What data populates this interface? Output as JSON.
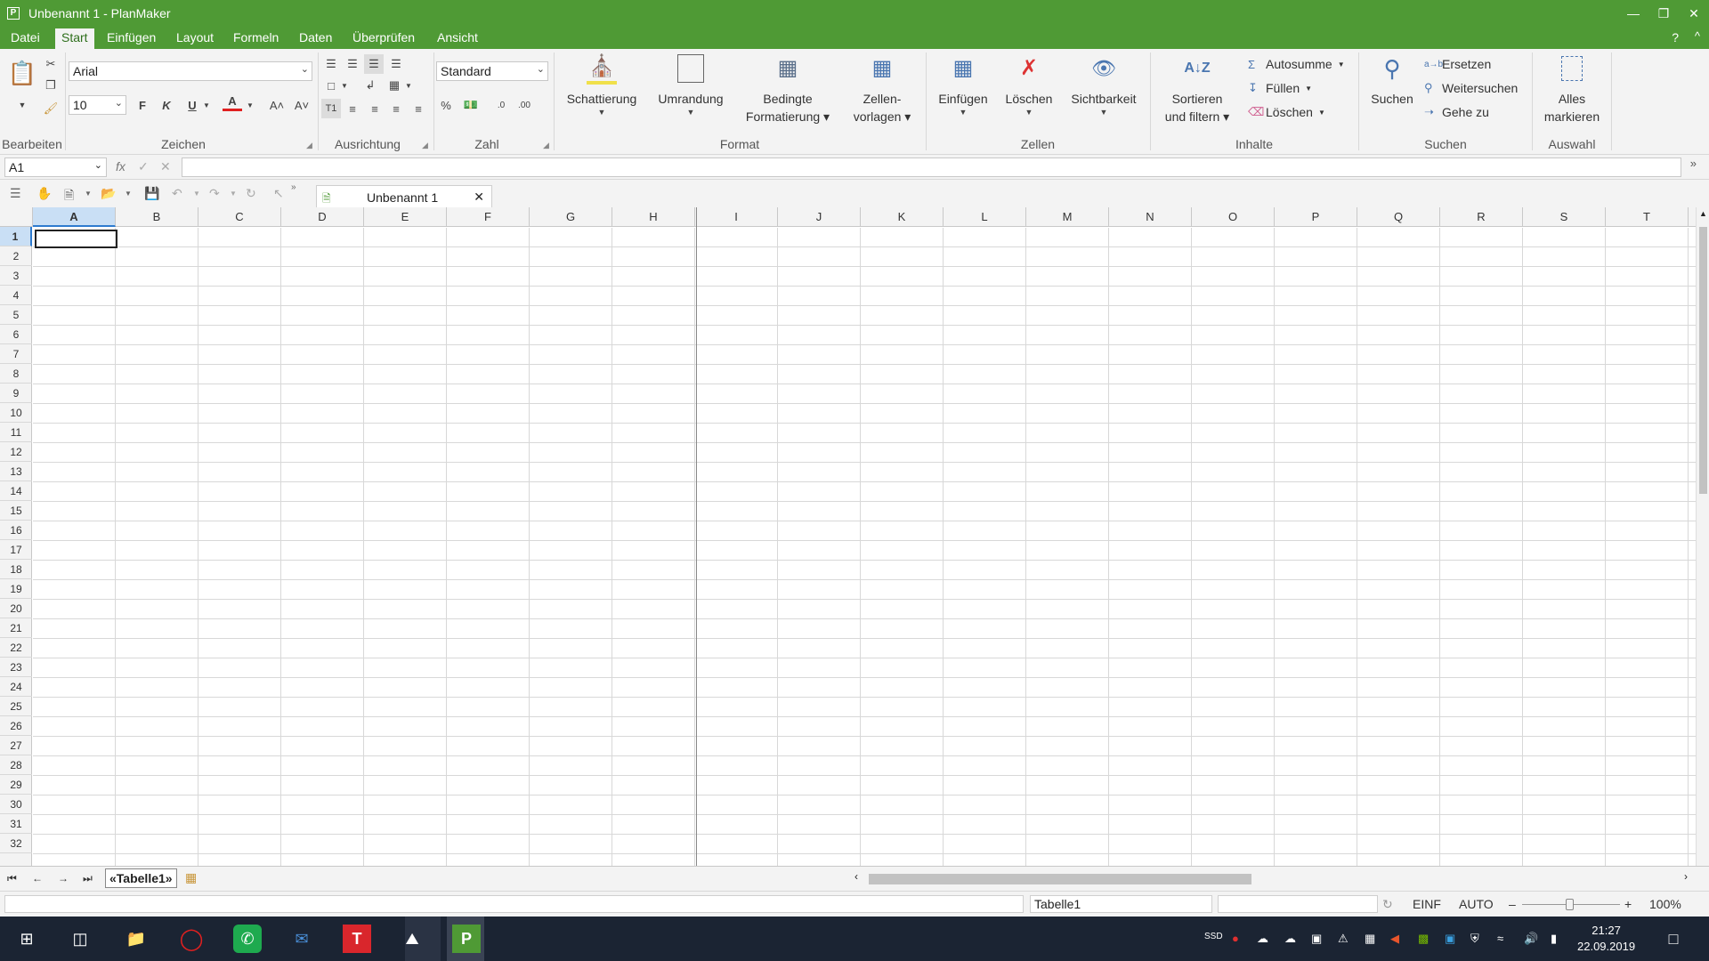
{
  "window": {
    "title": "Unbenannt 1 - PlanMaker",
    "app_icon_letter": "P"
  },
  "menu": {
    "items": [
      "Datei",
      "Start",
      "Einfügen",
      "Layout",
      "Formeln",
      "Daten",
      "Überprüfen",
      "Ansicht"
    ],
    "active": "Start",
    "help": "?",
    "collapse": "^"
  },
  "ribbon": {
    "font_name": "Arial",
    "font_size": "10",
    "number_format": "Standard",
    "bold_label": "F",
    "italic_label": "K",
    "underline_label": "U",
    "font_color_label": "A",
    "grow_label": "A˄",
    "shrink_label": "A˅",
    "percent_label": "%",
    "groups": [
      "Bearbeiten",
      "Zeichen",
      "Ausrichtung",
      "Zahl",
      "Format",
      "Zellen",
      "Inhalte",
      "Suchen",
      "Auswahl"
    ],
    "format_buttons": [
      {
        "line1": "Schattierung",
        "line2": ""
      },
      {
        "line1": "Umrandung",
        "line2": ""
      },
      {
        "line1": "Bedingte",
        "line2": "Formatierung ▾"
      },
      {
        "line1": "Zellen-",
        "line2": "vorlagen ▾"
      }
    ],
    "cells_buttons": [
      {
        "line1": "Einfügen",
        "line2": ""
      },
      {
        "line1": "Löschen",
        "line2": ""
      },
      {
        "line1": "Sichtbarkeit",
        "line2": ""
      }
    ],
    "sort_button": {
      "line1": "Sortieren",
      "line2": "und filtern ▾"
    },
    "autosum": "Autosumme",
    "fill": "Füllen",
    "delete": "Löschen",
    "search_button": "Suchen",
    "replace": "Ersetzen",
    "find_next": "Weitersuchen",
    "goto": "Gehe zu",
    "select_all": {
      "line1": "Alles",
      "line2": "markieren"
    }
  },
  "formula": {
    "cell_ref": "A1",
    "fx": "fx",
    "value": "",
    "expand": "»"
  },
  "doc_tab": {
    "label": "Unbenannt 1",
    "close": "✕"
  },
  "grid": {
    "columns": [
      "A",
      "B",
      "C",
      "D",
      "E",
      "F",
      "G",
      "H",
      "I",
      "J",
      "K",
      "L",
      "M",
      "N",
      "O",
      "P",
      "Q",
      "R",
      "S",
      "T"
    ],
    "rows": [
      "1",
      "2",
      "3",
      "4",
      "5",
      "6",
      "7",
      "8",
      "9",
      "10",
      "11",
      "12",
      "13",
      "14",
      "15",
      "16",
      "17",
      "18",
      "19",
      "20",
      "21",
      "22",
      "23",
      "24",
      "25",
      "26",
      "27",
      "28",
      "29",
      "30",
      "31",
      "32"
    ],
    "selected_column": "A",
    "selected_row": "1"
  },
  "sheet": {
    "tab": "«Tabelle1»"
  },
  "status": {
    "sheet_name": "Tabelle1",
    "mode1": "EINF",
    "mode2": "AUTO",
    "zoom": "100%",
    "zoom_minus": "–",
    "zoom_plus": "+"
  },
  "taskbar": {
    "time": "21:27",
    "date": "22.09.2019"
  }
}
